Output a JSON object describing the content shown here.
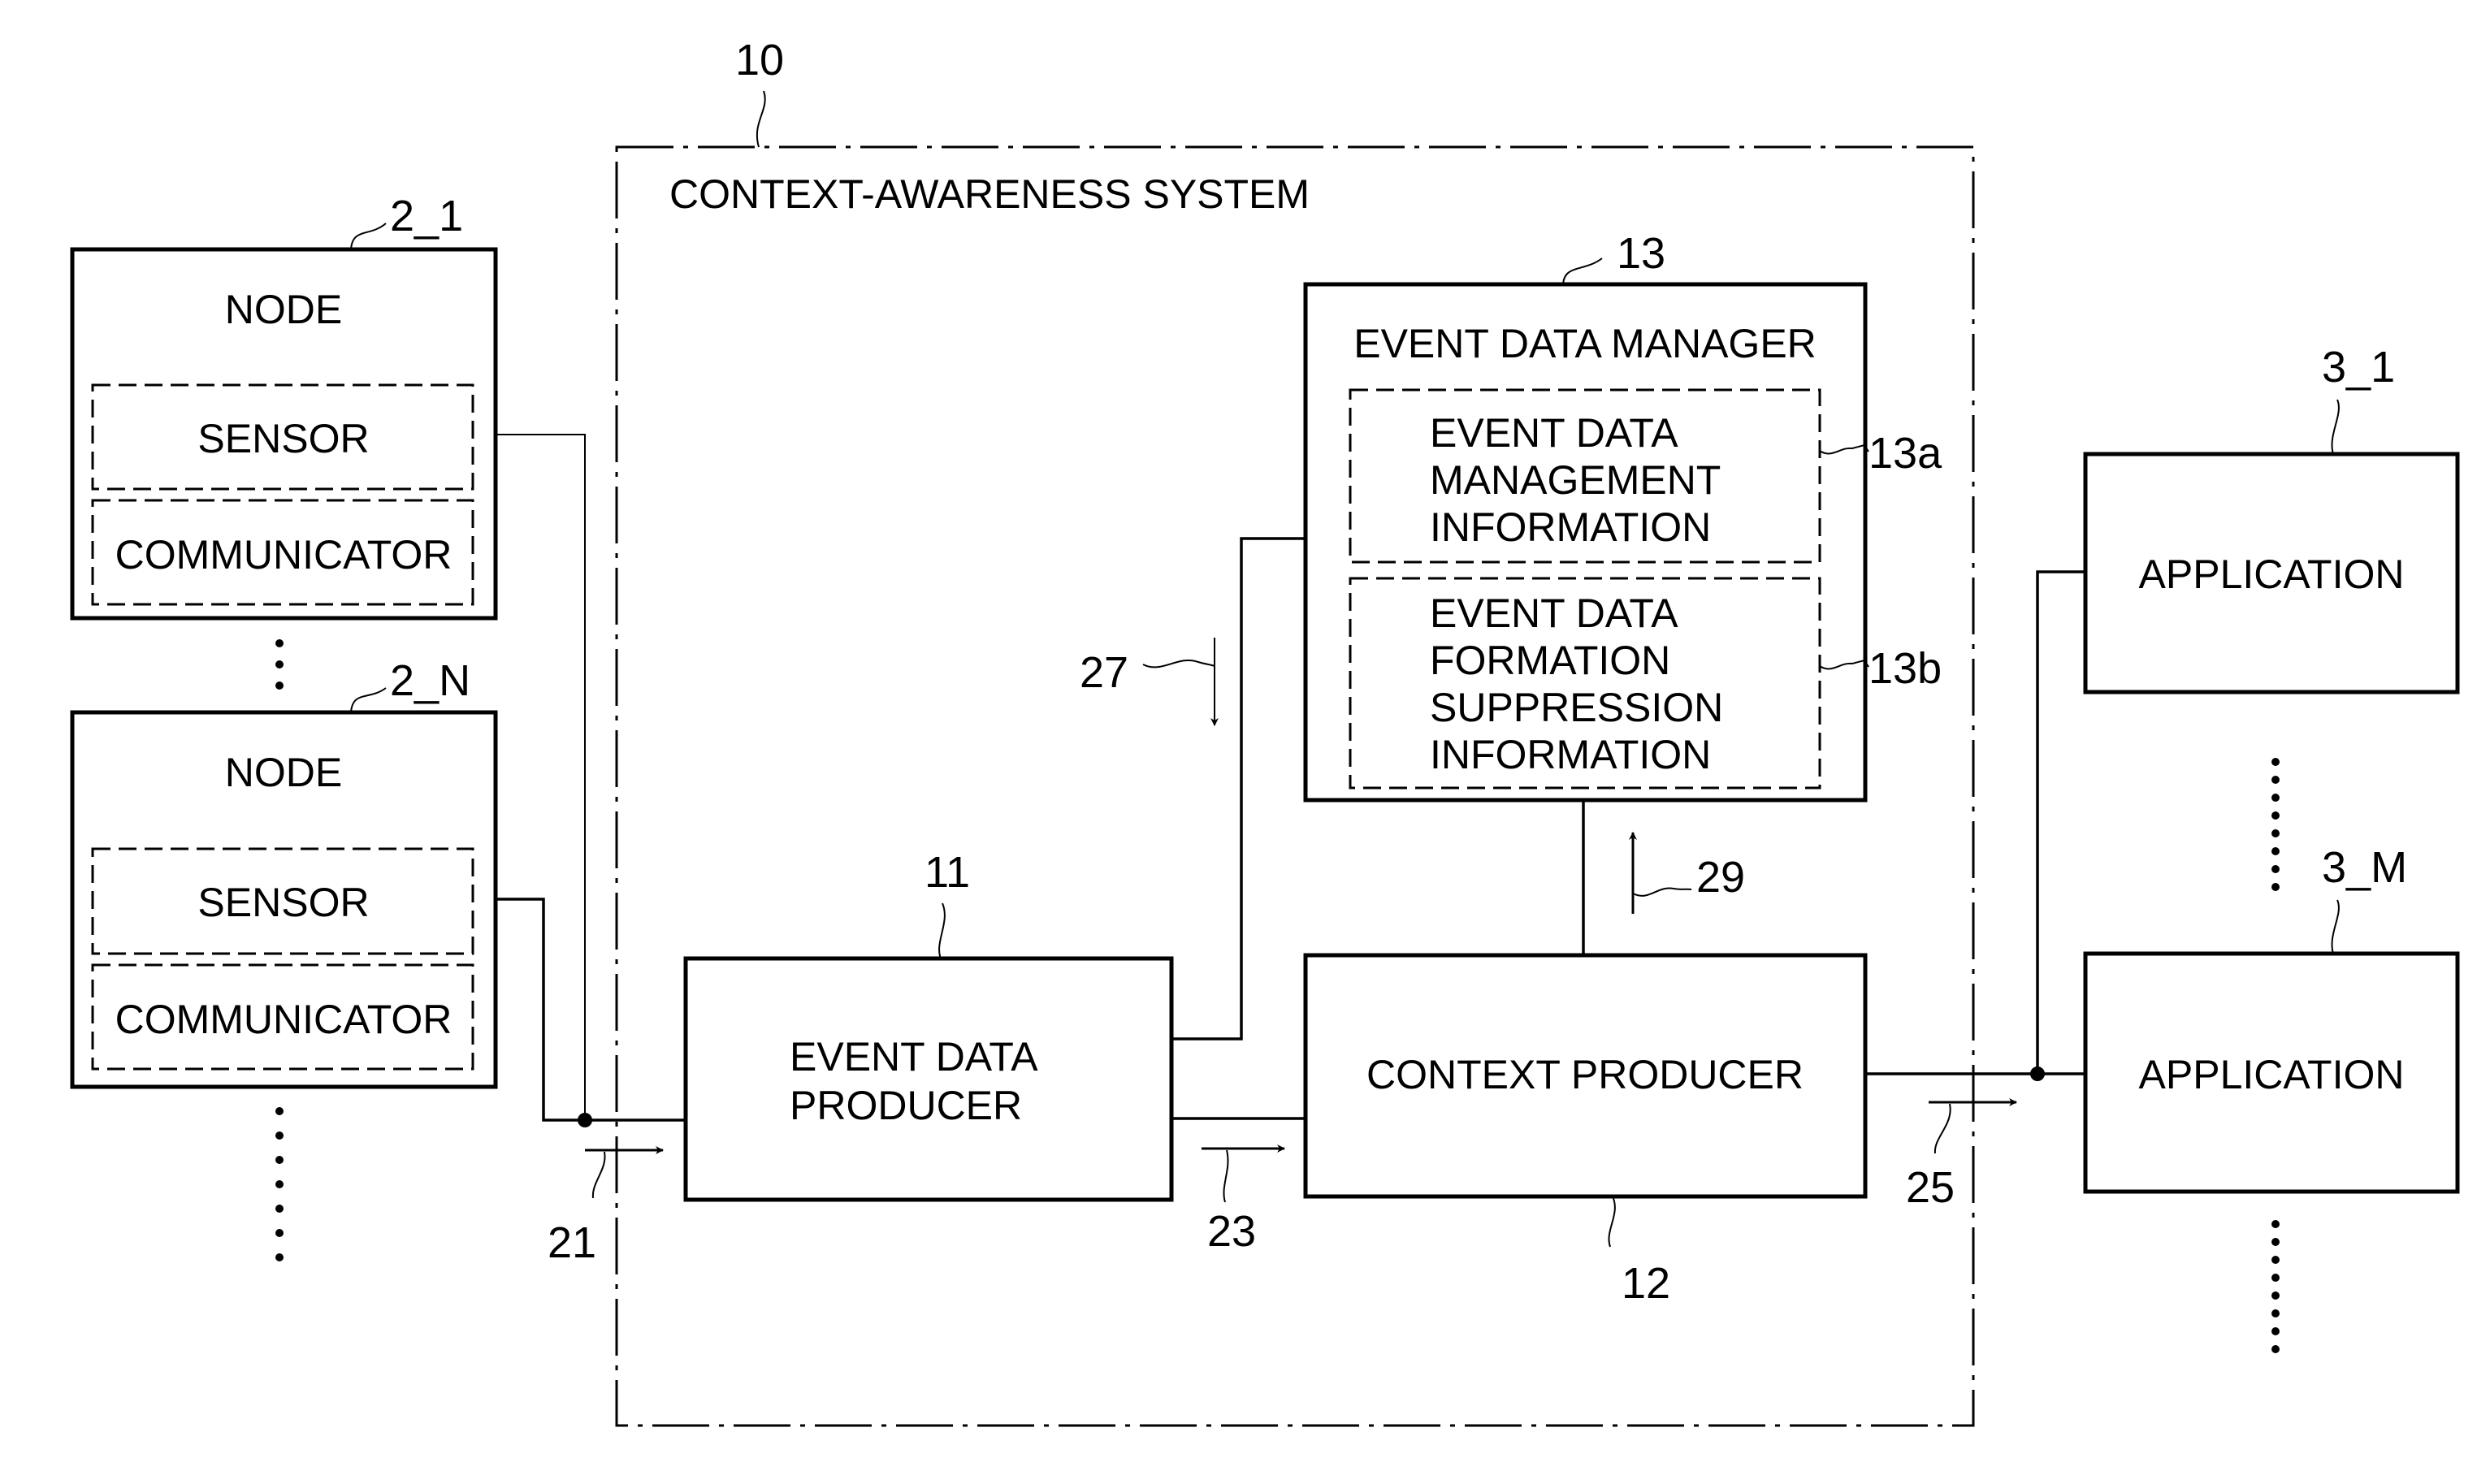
{
  "system": {
    "ref": "10",
    "title": "CONTEXT-AWARENESS SYSTEM"
  },
  "nodes": [
    {
      "ref": "2_1",
      "title": "NODE",
      "sensor": "SENSOR",
      "communicator": "COMMUNICATOR"
    },
    {
      "ref": "2_N",
      "title": "NODE",
      "sensor": "SENSOR",
      "communicator": "COMMUNICATOR"
    }
  ],
  "event_data_producer": {
    "ref": "11",
    "lines": [
      "EVENT DATA",
      "PRODUCER"
    ]
  },
  "context_producer": {
    "ref": "12",
    "label": "CONTEXT PRODUCER"
  },
  "event_data_manager": {
    "ref": "13",
    "title": "EVENT DATA MANAGER",
    "management_info": {
      "ref": "13a",
      "lines": [
        "EVENT DATA",
        "MANAGEMENT",
        "INFORMATION"
      ]
    },
    "suppression_info": {
      "ref": "13b",
      "lines": [
        "EVENT DATA",
        "FORMATION",
        "SUPPRESSION",
        "INFORMATION"
      ]
    }
  },
  "applications": [
    {
      "ref": "3_1",
      "label": "APPLICATION"
    },
    {
      "ref": "3_M",
      "label": "APPLICATION"
    }
  ],
  "flows": {
    "f21": "21",
    "f23": "23",
    "f25": "25",
    "f27": "27",
    "f29": "29"
  }
}
